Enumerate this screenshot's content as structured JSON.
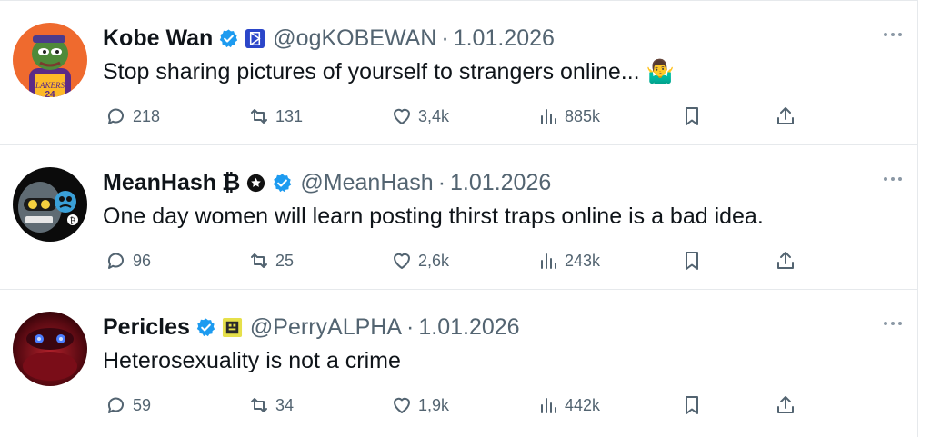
{
  "tweets": [
    {
      "name": "Kobe Wan",
      "handle": "@ogKOBEWAN",
      "separator": "·",
      "date": "1.01.2026",
      "text": "Stop sharing pictures of yourself to strangers online... 🤷‍♂️",
      "replies": "218",
      "retweets": "131",
      "likes": "3,4k",
      "views": "885k",
      "verified_color": "#1d9bf0"
    },
    {
      "name": "MeanHash",
      "name_suffix": "₿",
      "handle": "@MeanHash",
      "separator": "·",
      "date": "1.01.2026",
      "text": "One day women will learn posting thirst traps online is a bad idea.",
      "replies": "96",
      "retweets": "25",
      "likes": "2,6k",
      "views": "243k",
      "verified_color": "#1d9bf0"
    },
    {
      "name": "Pericles",
      "handle": "@PerryALPHA",
      "separator": "·",
      "date": "1.01.2026",
      "text": "Heterosexuality is not a crime",
      "replies": "59",
      "retweets": "34",
      "likes": "1,9k",
      "views": "442k",
      "verified_color": "#1d9bf0"
    }
  ]
}
